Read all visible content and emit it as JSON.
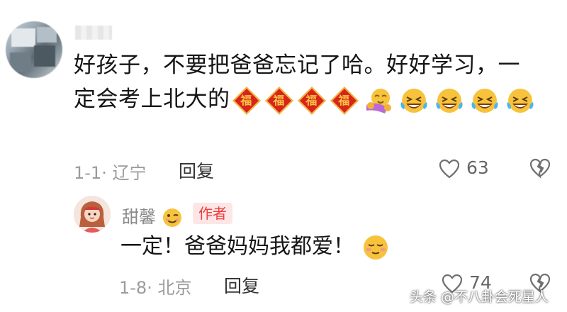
{
  "comment1": {
    "text_line": "好孩子，不要把爸爸忘记了哈。好好学习，一定会考上北大的",
    "fu_char": "福",
    "meta": "1-1· 辽宁",
    "reply": "回复",
    "likes": "63"
  },
  "comment2": {
    "name": "甜馨",
    "badge": "作者",
    "text": "一定！爸爸妈妈我都爱！",
    "meta": "1-8· 北京",
    "reply": "回复",
    "likes": "74"
  },
  "watermark": "头条 @不八卦会死星人",
  "icons": [
    "heart-icon",
    "broken-heart-icon",
    "fu-emoji-icon",
    "hug-emoji-icon",
    "laugh-cry-emoji-icon",
    "wink-emoji-icon",
    "shy-emoji-icon"
  ],
  "colors": {
    "badge_text": "#ef3d3d",
    "badge_bg": "#fde6e6",
    "fu_red": "#d9241c",
    "fu_gold": "#f1b83a"
  }
}
